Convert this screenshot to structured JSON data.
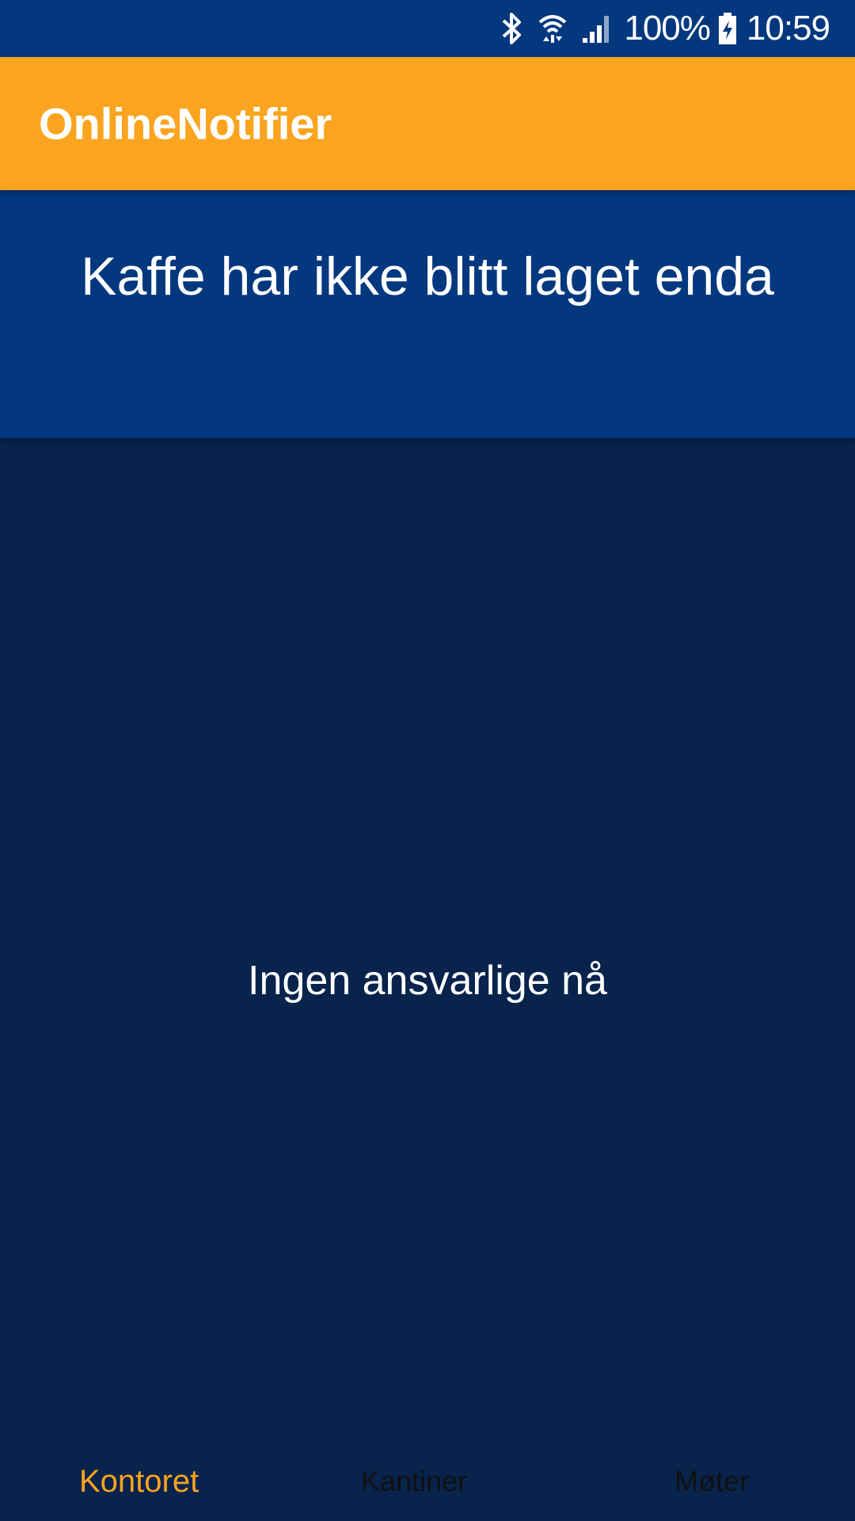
{
  "status_bar": {
    "icons": [
      "bluetooth-icon",
      "wifi-icon",
      "signal-icon",
      "battery-charging-icon"
    ],
    "battery": "100%",
    "time": "10:59"
  },
  "app_bar": {
    "title": "OnlineNotifier"
  },
  "coffee": {
    "status": "Kaffe har ikke blitt laget enda"
  },
  "main": {
    "responsible": "Ingen ansvarlige nå"
  },
  "bottom_nav": {
    "tabs": [
      {
        "label": "Kontoret",
        "active": true
      },
      {
        "label": "Kantiner",
        "active": false
      },
      {
        "label": "Møter",
        "active": false
      }
    ]
  },
  "colors": {
    "status_bar_bg": "#03387f",
    "app_bar_bg": "#faa41f",
    "banner_bg": "#03387f",
    "page_bg": "#08234c",
    "active_tab": "#faa41f",
    "inactive_tab": "#111111"
  }
}
